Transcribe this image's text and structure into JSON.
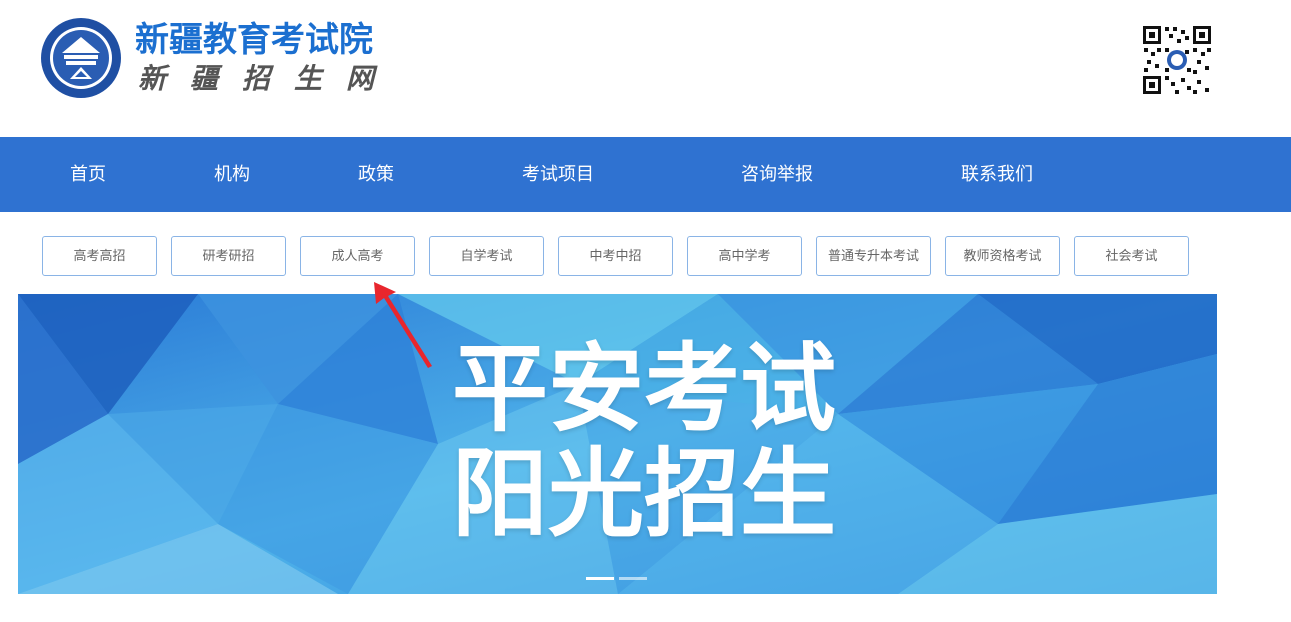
{
  "header": {
    "title": "新疆教育考试院",
    "subtitle": "新疆招生网",
    "emblem_icon": "xinjiang-exam-emblem-icon",
    "qr_icon": "qr-code-icon"
  },
  "nav": {
    "items": [
      {
        "label": "首页"
      },
      {
        "label": "机构"
      },
      {
        "label": "政策"
      },
      {
        "label": "考试项目"
      },
      {
        "label": "咨询举报"
      },
      {
        "label": "联系我们"
      }
    ]
  },
  "subnav": {
    "items": [
      {
        "label": "高考高招"
      },
      {
        "label": "研考研招"
      },
      {
        "label": "成人高考"
      },
      {
        "label": "自学考试"
      },
      {
        "label": "中考中招"
      },
      {
        "label": "高中学考"
      },
      {
        "label": "普通专升本考试"
      },
      {
        "label": "教师资格考试"
      },
      {
        "label": "社会考试"
      }
    ]
  },
  "banner": {
    "line1": "平安考试",
    "line2": "阳光招生",
    "slides_total": 2,
    "active_slide": 1
  },
  "annotation": {
    "arrow_icon": "red-arrow-icon",
    "arrow_color": "#e8262d"
  },
  "colors": {
    "brand_blue": "#1b6fd0",
    "nav_bg": "#2f72d1",
    "button_border": "#8ab4e6",
    "banner_light": "#5fc9f0",
    "banner_dark": "#1a66c9"
  }
}
